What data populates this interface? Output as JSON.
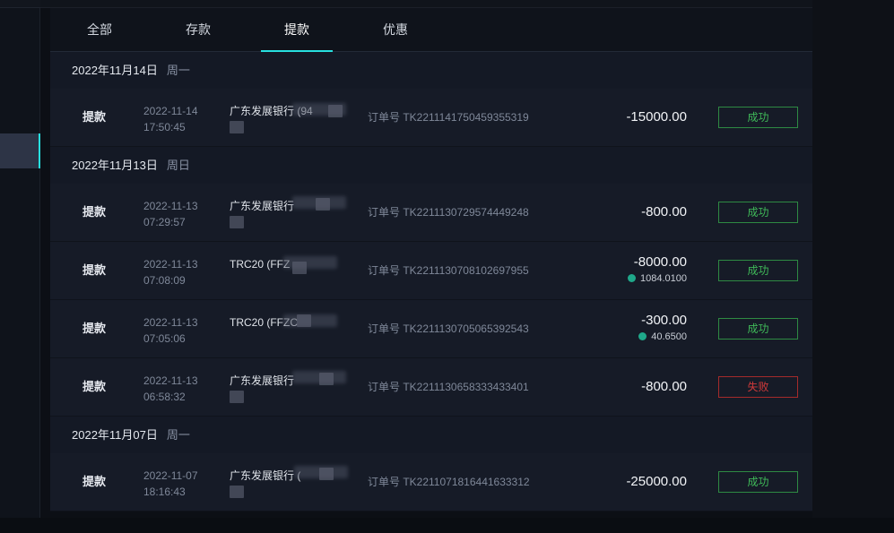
{
  "tabs": [
    {
      "label": "全部",
      "active": false
    },
    {
      "label": "存款",
      "active": false
    },
    {
      "label": "提款",
      "active": true
    },
    {
      "label": "优惠",
      "active": false
    }
  ],
  "groups": [
    {
      "date": "2022年11月14日",
      "weekday": "周一",
      "rows": [
        {
          "type": "提款",
          "date": "2022-11-14",
          "time": "17:50:45",
          "bank": "广东发展银行 (94",
          "order": "订单号 TK2211141750459355319",
          "amount": "-15000.00",
          "usdt": "",
          "status": "成功",
          "ok": true
        }
      ]
    },
    {
      "date": "2022年11月13日",
      "weekday": "周日",
      "rows": [
        {
          "type": "提款",
          "date": "2022-11-13",
          "time": "07:29:57",
          "bank": "广东发展银行",
          "order": "订单号 TK2211130729574449248",
          "amount": "-800.00",
          "usdt": "",
          "status": "成功",
          "ok": true
        },
        {
          "type": "提款",
          "date": "2022-11-13",
          "time": "07:08:09",
          "bank": "TRC20 (FFZ",
          "order": "订单号 TK2211130708102697955",
          "amount": "-8000.00",
          "usdt": "1084.0100",
          "status": "成功",
          "ok": true
        },
        {
          "type": "提款",
          "date": "2022-11-13",
          "time": "07:05:06",
          "bank": "TRC20 (FFZC",
          "order": "订单号 TK2211130705065392543",
          "amount": "-300.00",
          "usdt": "40.6500",
          "status": "成功",
          "ok": true
        },
        {
          "type": "提款",
          "date": "2022-11-13",
          "time": "06:58:32",
          "bank": "广东发展银行",
          "order": "订单号 TK2211130658333433401",
          "amount": "-800.00",
          "usdt": "",
          "status": "失败",
          "ok": false
        }
      ]
    },
    {
      "date": "2022年11月07日",
      "weekday": "周一",
      "rows": [
        {
          "type": "提款",
          "date": "2022-11-07",
          "time": "18:16:43",
          "bank": "广东发展银行 (",
          "order": "订单号 TK2211071816441633312",
          "amount": "-25000.00",
          "usdt": "",
          "status": "成功",
          "ok": true
        }
      ]
    }
  ]
}
